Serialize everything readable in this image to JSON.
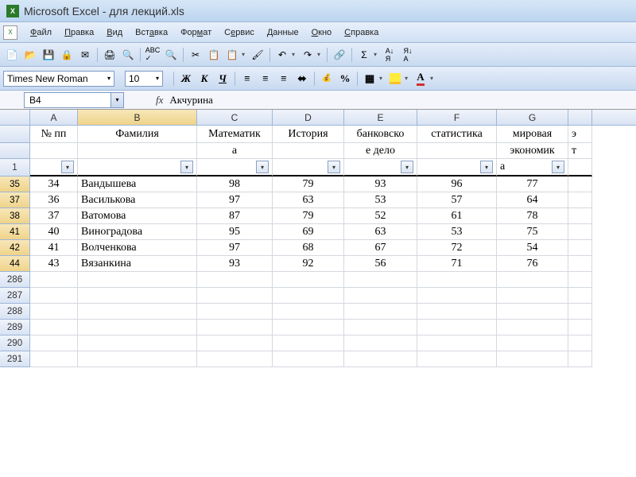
{
  "title": "Microsoft Excel - для лекций.xls",
  "menu": [
    "Файл",
    "Правка",
    "Вид",
    "Вставка",
    "Формат",
    "Сервис",
    "Данные",
    "Окно",
    "Справка"
  ],
  "menu_underlined": [
    "Ф",
    "П",
    "В",
    "В",
    "Ф",
    "С",
    "Д",
    "О",
    "С"
  ],
  "font_name": "Times New Roman",
  "font_size": "10",
  "fmt": {
    "bold": "Ж",
    "italic": "К",
    "underline": "Ч"
  },
  "namebox": "B4",
  "fx": "fx",
  "formula_value": "Акчурина",
  "columns": [
    "A",
    "B",
    "C",
    "D",
    "E",
    "F",
    "G"
  ],
  "headers_line1": [
    "№ пп",
    "Фамилия",
    "Математик",
    "История",
    "банковско",
    "статистика",
    "мировая"
  ],
  "headers_line2": [
    "",
    "",
    "а",
    "",
    "е дело",
    "",
    "экономик"
  ],
  "headers_line3_visible_g": "а",
  "selected_column": "B",
  "filter_row_number": "1",
  "data_rows": [
    {
      "rh": "35",
      "cells": [
        "34",
        "Вандышева",
        "98",
        "79",
        "93",
        "96",
        "77"
      ]
    },
    {
      "rh": "37",
      "cells": [
        "36",
        "Василькова",
        "97",
        "63",
        "53",
        "57",
        "64"
      ]
    },
    {
      "rh": "38",
      "cells": [
        "37",
        "Ватомова",
        "87",
        "79",
        "52",
        "61",
        "78"
      ]
    },
    {
      "rh": "41",
      "cells": [
        "40",
        "Виноградова",
        "95",
        "69",
        "63",
        "53",
        "75"
      ]
    },
    {
      "rh": "42",
      "cells": [
        "41",
        "Волченкова",
        "97",
        "68",
        "67",
        "72",
        "54"
      ]
    },
    {
      "rh": "44",
      "cells": [
        "43",
        "Вязанкина",
        "93",
        "92",
        "56",
        "71",
        "76"
      ]
    }
  ],
  "empty_row_headers": [
    "286",
    "287",
    "288",
    "289",
    "290",
    "291"
  ],
  "sigma": "Σ"
}
